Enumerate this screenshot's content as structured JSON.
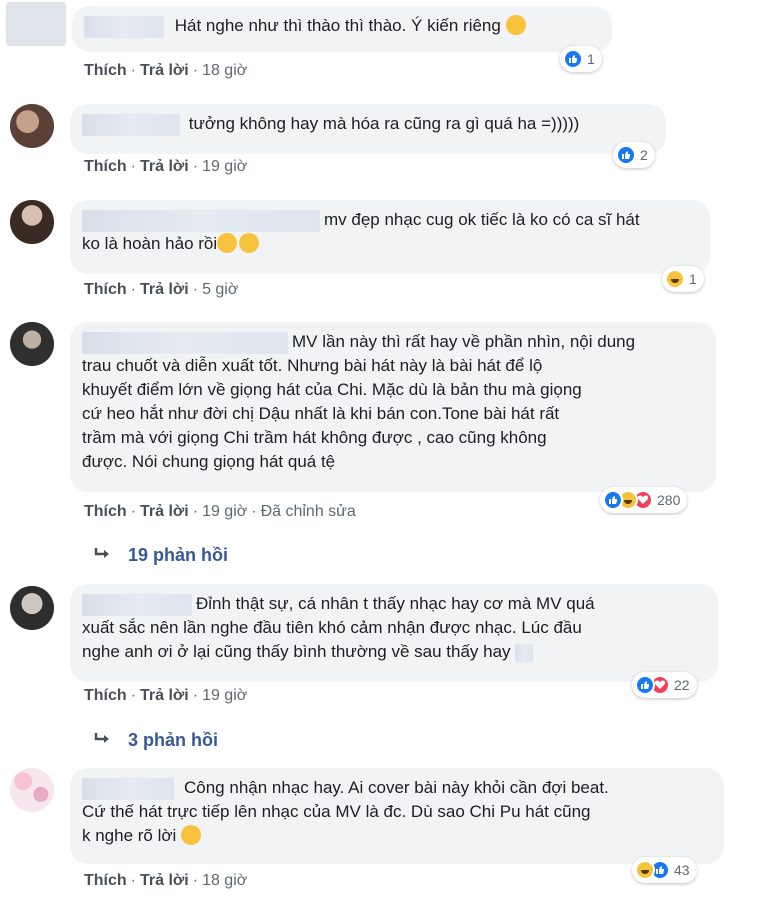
{
  "actions": {
    "like": "Thích",
    "reply": "Trả lời",
    "edited": "Đã chỉnh sửa"
  },
  "comments": [
    {
      "lines": [
        "Hát nghe như thì thào thì thào. Ý kiến riêng"
      ],
      "time": "18 giờ",
      "reaction_count": "1",
      "reactions": [
        "like"
      ]
    },
    {
      "lines": [
        "tưởng không hay mà hóa ra cũng ra gì quá ha =)))))"
      ],
      "time": "19 giờ",
      "reaction_count": "2",
      "reactions": [
        "like"
      ]
    },
    {
      "lines": [
        "mv đẹp nhạc cug ok tiếc là ko có ca sĩ hát",
        "ko là hoàn hảo rồi"
      ],
      "time": "5 giờ",
      "reaction_count": "1",
      "reactions": [
        "haha"
      ]
    },
    {
      "lines": [
        "MV lần này thì rất hay về phần nhìn, nội dung",
        "trau chuốt và diễn xuất tốt. Nhưng bài hát này là bài hát để lộ",
        "khuyết điểm lớn về giọng hát của Chi. Mặc dù là bản thu mà giọng",
        "cứ heo hắt như đời chị Dậu nhất là khi bán con.Tone bài hát rất",
        "trầm mà với giọng Chi trầm hát không được , cao cũng không",
        "được. Nói chung giọng hát quá tệ"
      ],
      "time": "19 giờ",
      "reaction_count": "280",
      "reactions": [
        "like",
        "haha",
        "love"
      ],
      "replies": "19 phản hồi"
    },
    {
      "lines": [
        "Đỉnh thật sự, cá nhân t thấy nhạc hay cơ mà MV quá",
        "xuất sắc nên lần nghe đầu tiên khó cảm nhận được nhạc. Lúc đầu",
        "nghe anh ơi ở lại cũng thấy bình thường về sau thấy hay"
      ],
      "time": "19 giờ",
      "reaction_count": "22",
      "reactions": [
        "like",
        "love"
      ],
      "replies": "3 phản hồi"
    },
    {
      "lines": [
        "Công nhận nhạc hay. Ai cover bài này khỏi cần đợi beat.",
        "Cứ thế hát trực tiếp lên nhạc của MV là đc. Dù sao Chi Pu hát cũng",
        "k nghe rõ lời"
      ],
      "time": "18 giờ",
      "reaction_count": "43",
      "reactions": [
        "haha",
        "like"
      ]
    }
  ]
}
